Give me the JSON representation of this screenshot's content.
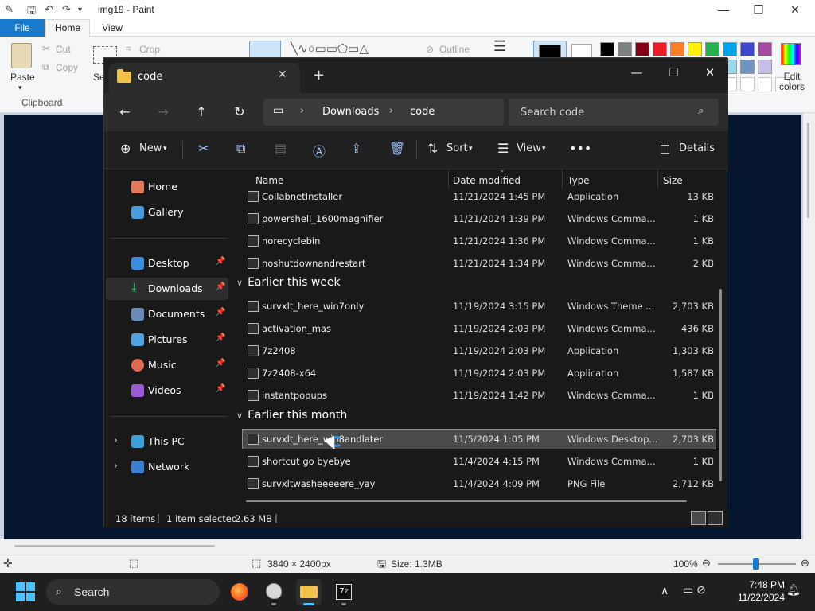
{
  "paint": {
    "title": "img19 - Paint",
    "tabs": [
      "File",
      "Home",
      "View"
    ],
    "ribbon": {
      "paste": "Paste",
      "cut": "Cut",
      "copy": "Copy",
      "crop": "Crop",
      "select_partial": "Se",
      "outline": "Outline",
      "clipboard_group": "Clipboard",
      "edit_colors": "Edit colors",
      "palette": [
        "#000000",
        "#7f7f7f",
        "#880015",
        "#ed1c24",
        "#ff7f27",
        "#fff200",
        "#22b14c",
        "#00a2e8",
        "#3f48cc",
        "#a349a4",
        "#ffffff",
        "#c3c3c3",
        "#b97a57",
        "#ffaec9",
        "#ffc90e",
        "#efe4b0",
        "#b5e61d",
        "#99d9ea",
        "#7092be",
        "#c8bfe7"
      ]
    },
    "status": {
      "dimensions": "3840 × 2400px",
      "size": "Size: 1.3MB",
      "zoom": "100%"
    }
  },
  "explorer": {
    "tab_title": "code",
    "breadcrumb": [
      "Downloads",
      "code"
    ],
    "search_placeholder": "Search code",
    "toolbar": {
      "new": "New",
      "sort": "Sort",
      "view": "View",
      "details": "Details"
    },
    "nav": {
      "home": "Home",
      "gallery": "Gallery",
      "desktop": "Desktop",
      "downloads": "Downloads",
      "documents": "Documents",
      "pictures": "Pictures",
      "music": "Music",
      "videos": "Videos",
      "this_pc": "This PC",
      "network": "Network"
    },
    "columns": [
      "Name",
      "Date modified",
      "Type",
      "Size"
    ],
    "rows_top": [
      {
        "name": "CollabnetInstaller",
        "date": "11/21/2024 1:45 PM",
        "type": "Application",
        "size": "13 KB"
      },
      {
        "name": "powershell_1600magnifier",
        "date": "11/21/2024 1:39 PM",
        "type": "Windows Comma...",
        "size": "1 KB"
      },
      {
        "name": "norecyclebin",
        "date": "11/21/2024 1:36 PM",
        "type": "Windows Comma...",
        "size": "1 KB"
      },
      {
        "name": "noshutdownandrestart",
        "date": "11/21/2024 1:34 PM",
        "type": "Windows Comma...",
        "size": "2 KB"
      }
    ],
    "group_week": "Earlier this week",
    "rows_week": [
      {
        "name": "survxlt_here_win7only",
        "date": "11/19/2024 3:15 PM",
        "type": "Windows Theme ...",
        "size": "2,703 KB"
      },
      {
        "name": "activation_mas",
        "date": "11/19/2024 2:03 PM",
        "type": "Windows Comma...",
        "size": "436 KB"
      },
      {
        "name": "7z2408",
        "date": "11/19/2024 2:03 PM",
        "type": "Application",
        "size": "1,303 KB"
      },
      {
        "name": "7z2408-x64",
        "date": "11/19/2024 2:03 PM",
        "type": "Application",
        "size": "1,587 KB"
      },
      {
        "name": "instantpopups",
        "date": "11/19/2024 1:42 PM",
        "type": "Windows Comma...",
        "size": "1 KB"
      }
    ],
    "group_month": "Earlier this month",
    "rows_month": [
      {
        "name": "survxlt_here_win8andlater",
        "date": "11/5/2024 1:05 PM",
        "type": "Windows Desktop...",
        "size": "2,703 KB"
      },
      {
        "name": "shortcut go byebye",
        "date": "11/4/2024 4:15 PM",
        "type": "Windows Comma...",
        "size": "1 KB"
      },
      {
        "name": "survxltwasheeeeere_yay",
        "date": "11/4/2024 4:09 PM",
        "type": "PNG File",
        "size": "2,712 KB"
      }
    ],
    "status": {
      "items": "18 items",
      "selected": "1 item selected",
      "size": "2.63 MB"
    }
  },
  "taskbar": {
    "search": "Search",
    "time": "7:48 PM",
    "date": "11/22/2024"
  },
  "colors": {
    "accent": "#4cc2ff",
    "folder": "#f0c24b",
    "file_tab": "#1979ca"
  }
}
